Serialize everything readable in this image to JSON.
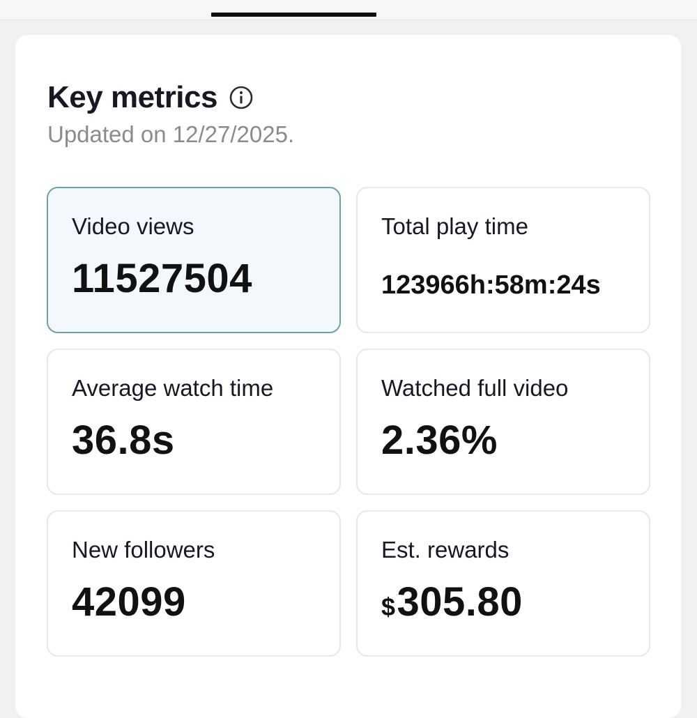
{
  "header": {
    "title": "Key metrics",
    "updated_text": "Updated on 12/27/2025."
  },
  "metrics": [
    {
      "label": "Video views",
      "value": "11527504",
      "selected": true
    },
    {
      "label": "Total play time",
      "value": "123966h:58m:24s"
    },
    {
      "label": "Average watch time",
      "value": "36.8s"
    },
    {
      "label": "Watched full video",
      "value": "2.36%"
    },
    {
      "label": "New followers",
      "value": "42099"
    },
    {
      "label": "Est. rewards",
      "currency": "$",
      "value": "305.80"
    }
  ],
  "icons": {
    "info": "info-circle-icon"
  },
  "colors": {
    "selected_border": "#6f9fae",
    "selected_background": "#f2f8fc",
    "text_primary": "#161823",
    "text_secondary": "#8a8b91"
  }
}
